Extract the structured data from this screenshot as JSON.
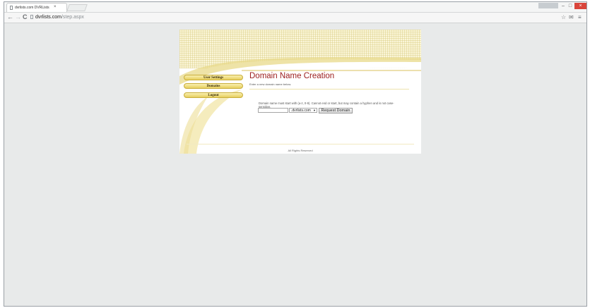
{
  "browser": {
    "tab_title": "dvrlists.com DVRLists",
    "tab_close": "×",
    "url_host": "dvrlists.com",
    "url_path": "/step.aspx",
    "nav_back": "←",
    "nav_forward": "→",
    "nav_reload": "C",
    "win_min": "–",
    "win_max": "□",
    "win_close": "×",
    "star": "☆",
    "mail": "✉",
    "menu": "≡"
  },
  "sidebar": {
    "items": [
      {
        "label": "User Settings"
      },
      {
        "label": "Domains"
      },
      {
        "label": "Logout"
      }
    ]
  },
  "main": {
    "title": "Domain Name Creation",
    "subtitle": "Enter a new domain name below.",
    "note": "Domain name must start with (a-z, 0-9). Cannot end or start, but may contain a hyphen and is not case-sensitive.",
    "input_value": "",
    "select_value": ".dvrlists.com",
    "select_arrow": "▼",
    "request_button": "Request Domain"
  },
  "footer": {
    "text": "All Rights Reserved"
  },
  "colors": {
    "accent": "#9b1c1c",
    "nav_gold": "#e7cf5e",
    "grid_bg": "#fbf6d9",
    "canvas": "#e8eaea"
  }
}
